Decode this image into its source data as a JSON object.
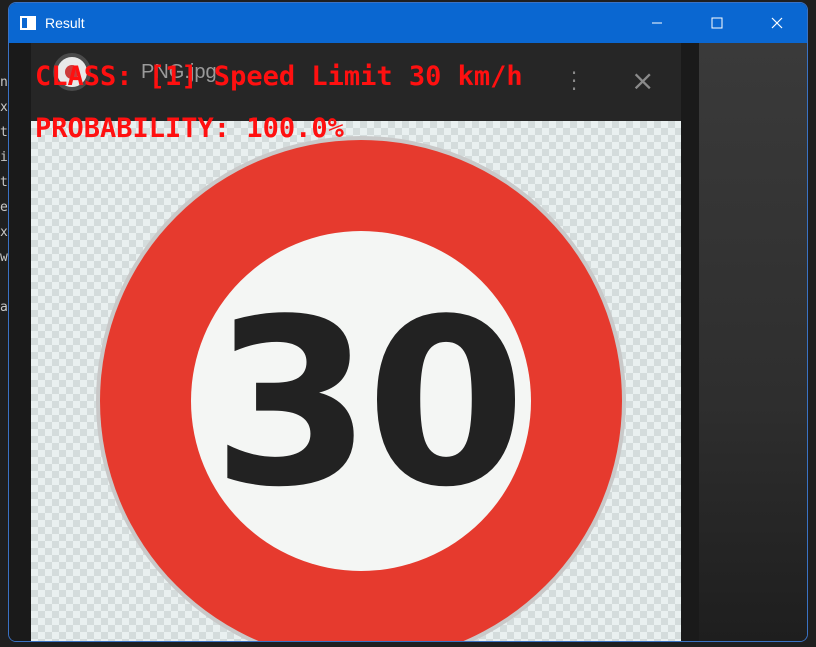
{
  "window": {
    "title": "Result",
    "controls": {
      "minimize_icon": "minimize-icon",
      "maximize_icon": "maximize-icon",
      "close_icon": "close-icon"
    },
    "titlebar_color": "#0a67d1"
  },
  "background": {
    "editor_chars": "n\nx\nt\ni\nt\ne\nx\nw\n\na"
  },
  "camera_feed": {
    "viewer": {
      "filename": "PNG.jpg",
      "sign_number": "30",
      "sign_ring_color": "#e63a2e"
    },
    "overlay": {
      "class_label": "CLASS: [1] Speed Limit 30 km/h",
      "probability_label": "PROBABILITY: 100.0%",
      "text_color": "#ff1010"
    }
  }
}
